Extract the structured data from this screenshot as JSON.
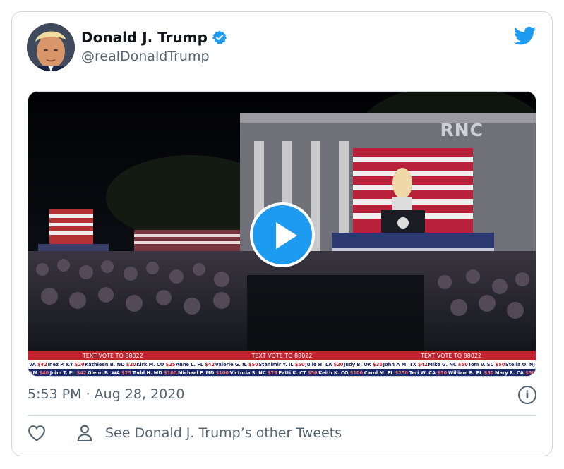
{
  "tweet": {
    "author_name": "Donald J. Trump",
    "handle": "@realDonaldTrump",
    "timestamp": "5:53 PM · Aug 28, 2020"
  },
  "media": {
    "type": "video",
    "watermark": "RNC",
    "ticker_banner": [
      "TEXT VOTE TO 88022",
      "TEXT VOTE TO 88022",
      "TEXT VOTE TO 88022"
    ],
    "ticker_row1": [
      {
        "name": "VA",
        "amt": "$42"
      },
      {
        "name": "Inez P. KY",
        "amt": "$20"
      },
      {
        "name": "Kathleen B. ND",
        "amt": "$20"
      },
      {
        "name": "Kirk M. CO",
        "amt": "$25"
      },
      {
        "name": "Anne L. FL",
        "amt": "$42"
      },
      {
        "name": "Valerie G. IL",
        "amt": "$50"
      },
      {
        "name": "Stanimir Y. IL",
        "amt": "$50"
      },
      {
        "name": "Julie H. LA",
        "amt": "$20"
      },
      {
        "name": "Judy B. OK",
        "amt": "$35"
      },
      {
        "name": "John A M. TX",
        "amt": "$42"
      },
      {
        "name": "Mike G. NC",
        "amt": "$50"
      },
      {
        "name": "Tom V. SC",
        "amt": "$50"
      },
      {
        "name": "Stella O. NJ",
        "amt": ""
      }
    ],
    "ticker_row2": [
      {
        "name": "NM",
        "amt": "$40"
      },
      {
        "name": "John T. FL",
        "amt": "$42"
      },
      {
        "name": "Glenn B. WA",
        "amt": "$25"
      },
      {
        "name": "Todd H. MD",
        "amt": "$100"
      },
      {
        "name": "Michael F. MD",
        "amt": "$100"
      },
      {
        "name": "Victoria S. NC",
        "amt": "$75"
      },
      {
        "name": "Patti K. CT",
        "amt": "$50"
      },
      {
        "name": "Keith K. CO",
        "amt": "$100"
      },
      {
        "name": "Carol M. FL",
        "amt": "$250"
      },
      {
        "name": "Teri W. CA",
        "amt": "$50"
      },
      {
        "name": "William B. FL",
        "amt": "$50"
      },
      {
        "name": "Mary R. CA",
        "amt": "$50"
      }
    ]
  },
  "footer": {
    "info_glyph": "i",
    "other_tweets_label": "See Donald J. Trump’s other Tweets"
  },
  "colors": {
    "accent": "#1d9bf0",
    "text_secondary": "#536471",
    "ticker_red": "#c5222f",
    "ticker_navy": "#1b2a6b"
  }
}
